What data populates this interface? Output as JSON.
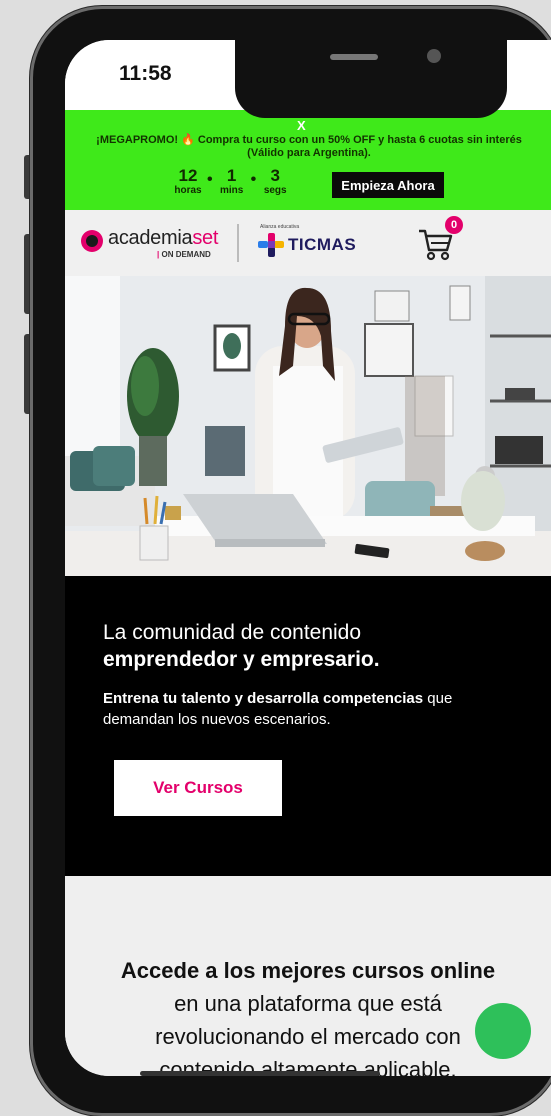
{
  "status_bar": {
    "time": "11:58"
  },
  "promo": {
    "close_label": "X",
    "text_prefix": "¡MEGAPROMO!",
    "emoji": "🔥",
    "text": "Compra tu curso con un 50% OFF y hasta 6 cuotas sin interés (Válido para Argentina).",
    "countdown": [
      {
        "value": "12",
        "label": "horas"
      },
      {
        "value": "1",
        "label": "mins"
      },
      {
        "value": "3",
        "label": "segs"
      }
    ],
    "separator": "•",
    "cta_label": "Empieza Ahora"
  },
  "navbar": {
    "logo_text_dark": "academia",
    "logo_text_pink": "set",
    "logo_sub": "ON DEMAND",
    "alianza": "Alianza educativa",
    "partner": "TICMAS",
    "cart_count": "0"
  },
  "hero": {
    "title_line1": "La comunidad de contenido",
    "title_line2": "emprendedor y empresario.",
    "subtitle_bold": "Entrena tu talento y desarrolla competencias",
    "subtitle_rest": " que demandan los nuevos escenarios.",
    "button_label": "Ver Cursos"
  },
  "section2": {
    "heading_bold": "Accede a los mejores cursos online",
    "line2": "en una plataforma que está",
    "line3": "revolucionando el mercado con",
    "line4": "contenido altamente aplicable."
  },
  "colors": {
    "brand_pink": "#e3006b",
    "promo_green": "#3fe91a",
    "fab_green": "#2ec05a"
  }
}
